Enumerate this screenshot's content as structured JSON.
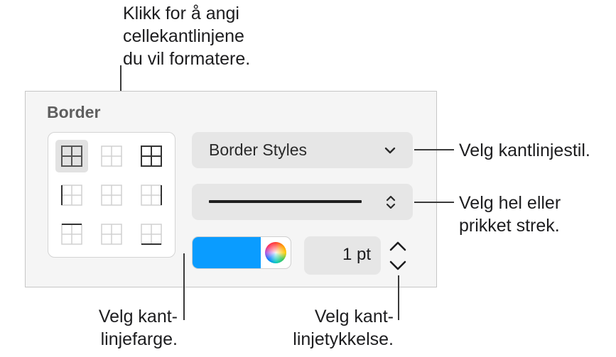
{
  "callouts": {
    "top": "Klikk for å angi\ncellekantlinjene\ndu vil formatere.",
    "border_style": "Velg kantlinjestil.",
    "line_style": "Velg hel eller\nprikket strek.",
    "fill_color": "Velg kant-\nlinjefarge.",
    "thickness": "Velg kant-\nlinjetykkelse."
  },
  "panel": {
    "section_title": "Border",
    "border_styles_label": "Border Styles",
    "stroke_value": "1 pt",
    "border_color": "#0a9cff",
    "selected_border_option": "all borders"
  },
  "icons": {
    "dropdown": "chevron-down-icon",
    "popup": "up-down-chevron-icon",
    "color_picker": "color-wheel-icon",
    "stepper_up": "chevron-up-icon",
    "stepper_down": "chevron-down-icon"
  }
}
